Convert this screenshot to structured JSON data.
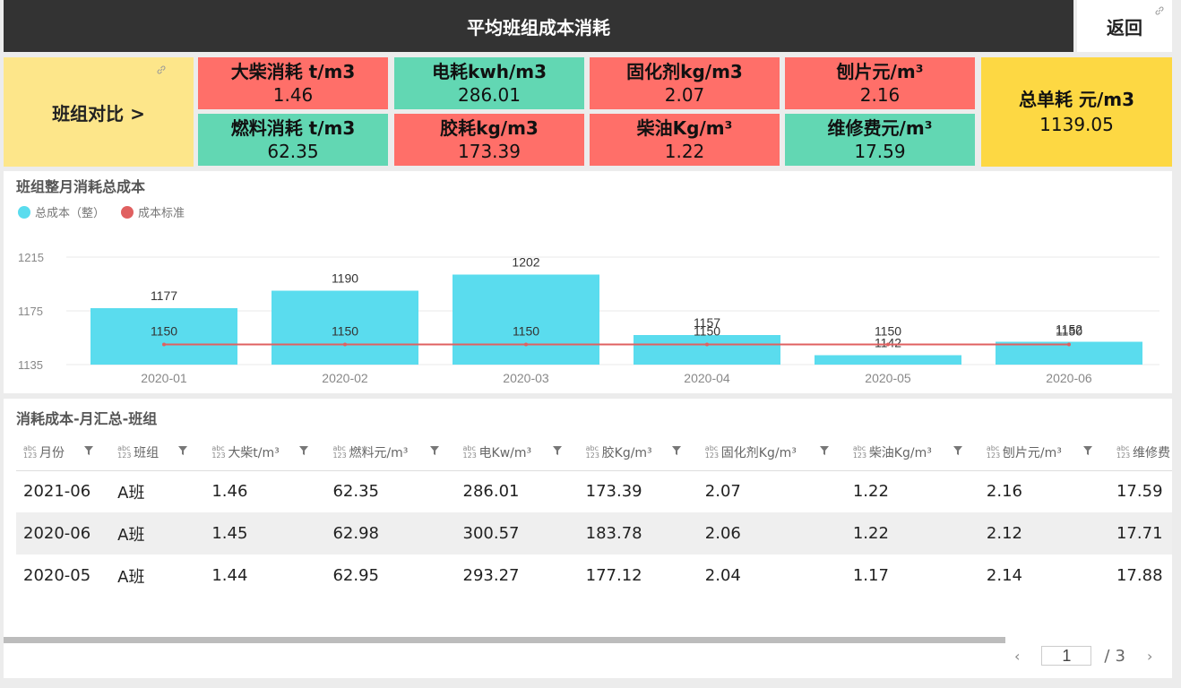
{
  "header": {
    "title": "平均班组成本消耗",
    "back_label": "返回"
  },
  "compare": {
    "label": "班组对比 >"
  },
  "kpis": [
    {
      "label": "大柴消耗 t/m3",
      "value": "1.46",
      "status": "red"
    },
    {
      "label": "电耗kwh/m3",
      "value": "286.01",
      "status": "green"
    },
    {
      "label": "固化剂kg/m3",
      "value": "2.07",
      "status": "red"
    },
    {
      "label": "刨片元/m³",
      "value": "2.16",
      "status": "red"
    },
    {
      "label": "燃料消耗 t/m3",
      "value": "62.35",
      "status": "green"
    },
    {
      "label": "胶耗kg/m3",
      "value": "173.39",
      "status": "red"
    },
    {
      "label": "柴油Kg/m³",
      "value": "1.22",
      "status": "red"
    },
    {
      "label": "维修费元/m³",
      "value": "17.59",
      "status": "green"
    }
  ],
  "total": {
    "label": "总单耗 元/m3",
    "value": "1139.05"
  },
  "colors": {
    "red": "#ff6f69",
    "green": "#62d7b3",
    "yellow": "#fdd843",
    "bar": "#5adcee",
    "line": "#e06060"
  },
  "chart_panel": {
    "title": "班组整月消耗总成本"
  },
  "chart_data": {
    "type": "bar",
    "categories": [
      "2020-01",
      "2020-02",
      "2020-03",
      "2020-04",
      "2020-05",
      "2020-06"
    ],
    "series": [
      {
        "name": "总成本（整）",
        "type": "bar",
        "values": [
          1177,
          1190,
          1202,
          1157,
          1142,
          1152
        ]
      },
      {
        "name": "成本标准",
        "type": "line",
        "values": [
          1150,
          1150,
          1150,
          1150,
          1150,
          1150
        ]
      }
    ],
    "y_ticks": [
      "1215",
      "1175",
      "1135"
    ],
    "ylim": [
      1135,
      1215
    ],
    "legend_position": "top-left",
    "grid": true
  },
  "table_panel": {
    "title": "消耗成本-月汇总-班组",
    "columns": [
      "月份",
      "班组",
      "大柴t/m³",
      "燃料元/m³",
      "电Kw/m³",
      "胶Kg/m³",
      "固化剂Kg/m³",
      "柴油Kg/m³",
      "刨片元/m³",
      "维修费"
    ],
    "type_badge": "abc\n123",
    "rows": [
      [
        "2021-06",
        "A班",
        "1.46",
        "62.35",
        "286.01",
        "173.39",
        "2.07",
        "1.22",
        "2.16",
        "17.59"
      ],
      [
        "2020-06",
        "A班",
        "1.45",
        "62.98",
        "300.57",
        "183.78",
        "2.06",
        "1.22",
        "2.12",
        "17.71"
      ],
      [
        "2020-05",
        "A班",
        "1.44",
        "62.95",
        "293.27",
        "177.12",
        "2.04",
        "1.17",
        "2.14",
        "17.88"
      ]
    ]
  },
  "pager": {
    "current": "1",
    "separator": "/",
    "total_pages": "3",
    "prev_icon": "chevron-left-icon",
    "next_icon": "chevron-right-icon"
  }
}
